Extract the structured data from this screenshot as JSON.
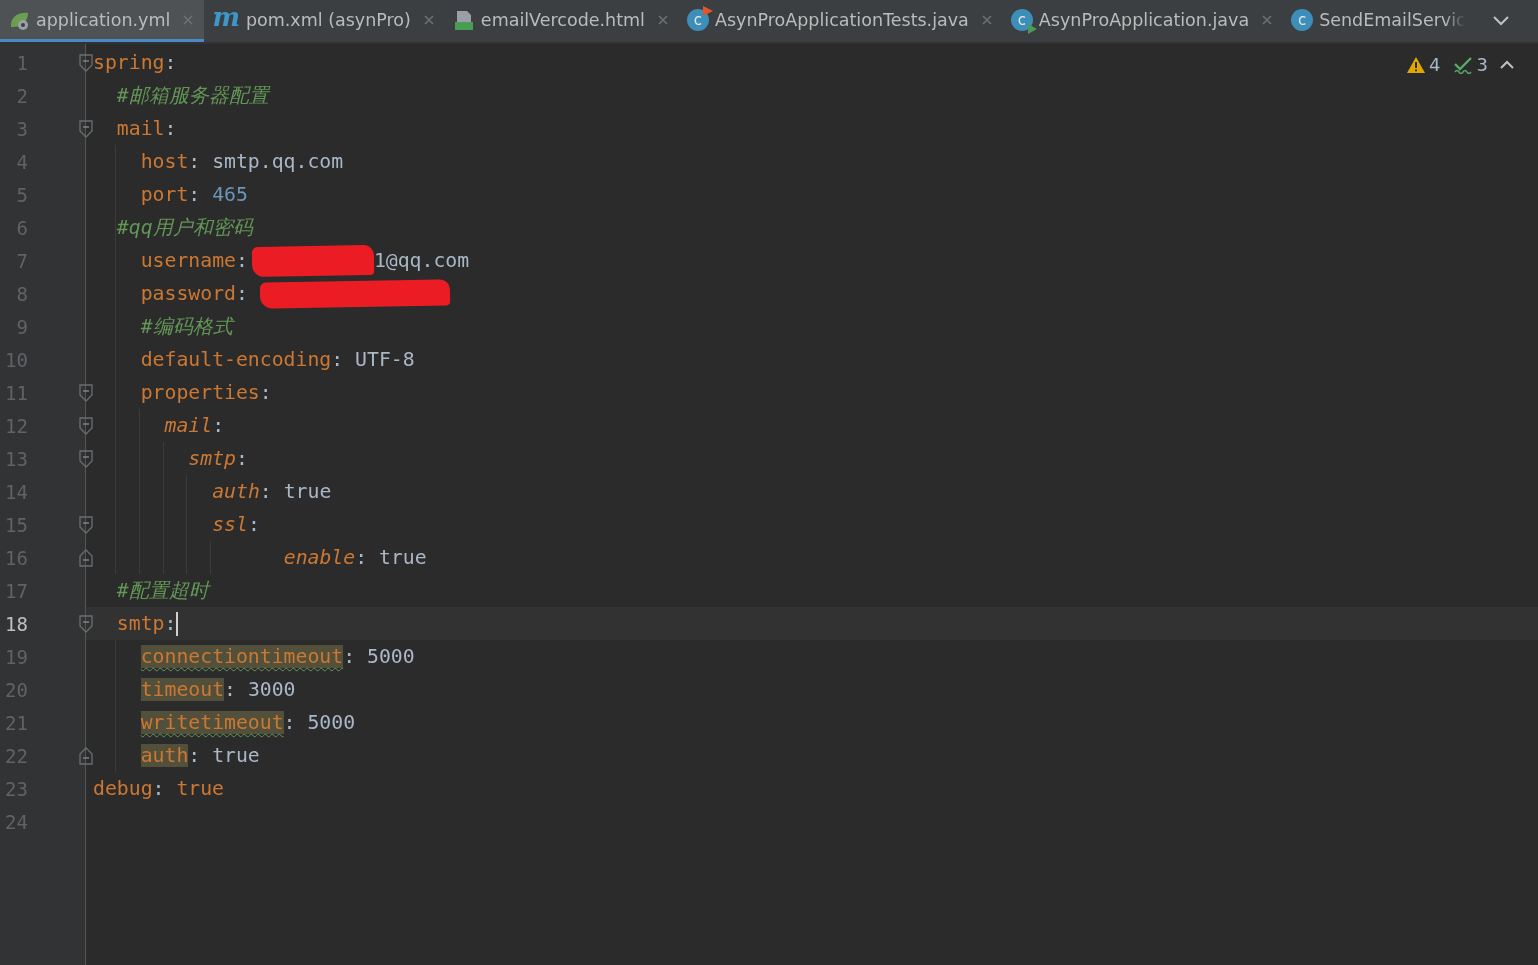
{
  "tabs": [
    {
      "label": "application.yml",
      "kind": "yaml",
      "selected": true,
      "closable": true
    },
    {
      "label": "pom.xml (asynPro)",
      "kind": "maven",
      "icon_text": "m",
      "selected": false,
      "closable": true
    },
    {
      "label": "emailVercode.html",
      "kind": "html",
      "selected": false,
      "closable": true
    },
    {
      "label": "AsynProApplicationTests.java",
      "kind": "test",
      "icon_text": "c",
      "selected": false,
      "closable": true
    },
    {
      "label": "AsynProApplication.java",
      "kind": "runnable",
      "icon_text": "c",
      "selected": false,
      "closable": true
    },
    {
      "label": "SendEmailServic",
      "kind": "class",
      "icon_text": "c",
      "selected": false,
      "closable": false
    }
  ],
  "inspections": {
    "warnings": "4",
    "passed": "3"
  },
  "lines": [
    {
      "number": "1",
      "key": "spring",
      "colon": ":",
      "foldable": true,
      "selected": false,
      "children": [
        {
          "number": "2",
          "comment": "#邮箱服务器配置",
          "selected": false
        },
        {
          "number": "3",
          "key": "mail",
          "colon": ":",
          "foldable": true,
          "selected": false,
          "children": [
            {
              "number": "4",
              "key": "host",
              "colon": ":",
              "value": {
                "text": "smtp.qq.com",
                "kind": "plain"
              },
              "selected": false
            },
            {
              "number": "5",
              "key": "port",
              "colon": ":",
              "value": {
                "text": "465",
                "kind": "number"
              },
              "selected": false
            },
            {
              "number": "6",
              "comment": "#qq用户和密码",
              "dedent": true,
              "selected": false
            },
            {
              "number": "7",
              "key": "username",
              "colon": ":",
              "redacted": true,
              "value": {
                "text": "1@qq.com",
                "kind": "plain"
              },
              "selected": false
            },
            {
              "number": "8",
              "key": "password",
              "colon": ":",
              "redacted": true,
              "selected": false
            },
            {
              "number": "9",
              "comment": "#编码格式",
              "selected": false
            },
            {
              "number": "10",
              "key": "default-encoding",
              "colon": ":",
              "value": {
                "text": "UTF-8",
                "kind": "plain"
              },
              "selected": false
            },
            {
              "number": "11",
              "key": "properties",
              "colon": ":",
              "foldable": true,
              "selected": false,
              "children": [
                {
                  "number": "12",
                  "key": "mail",
                  "colon": ":",
                  "italic": true,
                  "foldable": true,
                  "selected": false,
                  "children": [
                    {
                      "number": "13",
                      "key": "smtp",
                      "colon": ":",
                      "italic": true,
                      "foldable": true,
                      "selected": false,
                      "children": [
                        {
                          "number": "14",
                          "key": "auth",
                          "colon": ":",
                          "italic": true,
                          "value": {
                            "text": "true",
                            "kind": "plain"
                          },
                          "selected": false
                        },
                        {
                          "number": "15",
                          "key": "ssl",
                          "colon": ":",
                          "italic": true,
                          "foldable": true,
                          "selected": false,
                          "children": [
                            {
                              "number": "16",
                              "key": "enable",
                              "colon": ":",
                              "italic": true,
                              "extra_indent": true,
                              "fold_end": true,
                              "value": {
                                "text": "true",
                                "kind": "plain"
                              },
                              "selected": false
                            }
                          ]
                        }
                      ]
                    }
                  ]
                }
              ]
            }
          ]
        },
        {
          "number": "17",
          "comment": "#配置超时",
          "selected": false
        },
        {
          "number": "18",
          "key": "smtp",
          "colon": ":",
          "foldable": true,
          "caret": true,
          "selected": true,
          "children": [
            {
              "number": "19",
              "key": "connectiontimeout",
              "colon": ":",
              "highlighted": true,
              "wavy": true,
              "value": {
                "text": "5000",
                "kind": "plain"
              },
              "selected": false
            },
            {
              "number": "20",
              "key": "timeout",
              "colon": ":",
              "highlighted": true,
              "wavy": false,
              "value": {
                "text": "3000",
                "kind": "plain"
              },
              "selected": false
            },
            {
              "number": "21",
              "key": "writetimeout",
              "colon": ":",
              "highlighted": true,
              "wavy": true,
              "value": {
                "text": "5000",
                "kind": "plain"
              },
              "selected": false
            },
            {
              "number": "22",
              "key": "auth",
              "colon": ":",
              "highlighted": true,
              "wavy": false,
              "fold_end": true,
              "value": {
                "text": "true",
                "kind": "plain"
              },
              "selected": false
            }
          ]
        }
      ]
    },
    {
      "number": "23",
      "key": "debug",
      "colon": ":",
      "value": {
        "text": "true",
        "kind": "keyword"
      },
      "selected": false
    },
    {
      "number": "24",
      "selected": false
    }
  ]
}
